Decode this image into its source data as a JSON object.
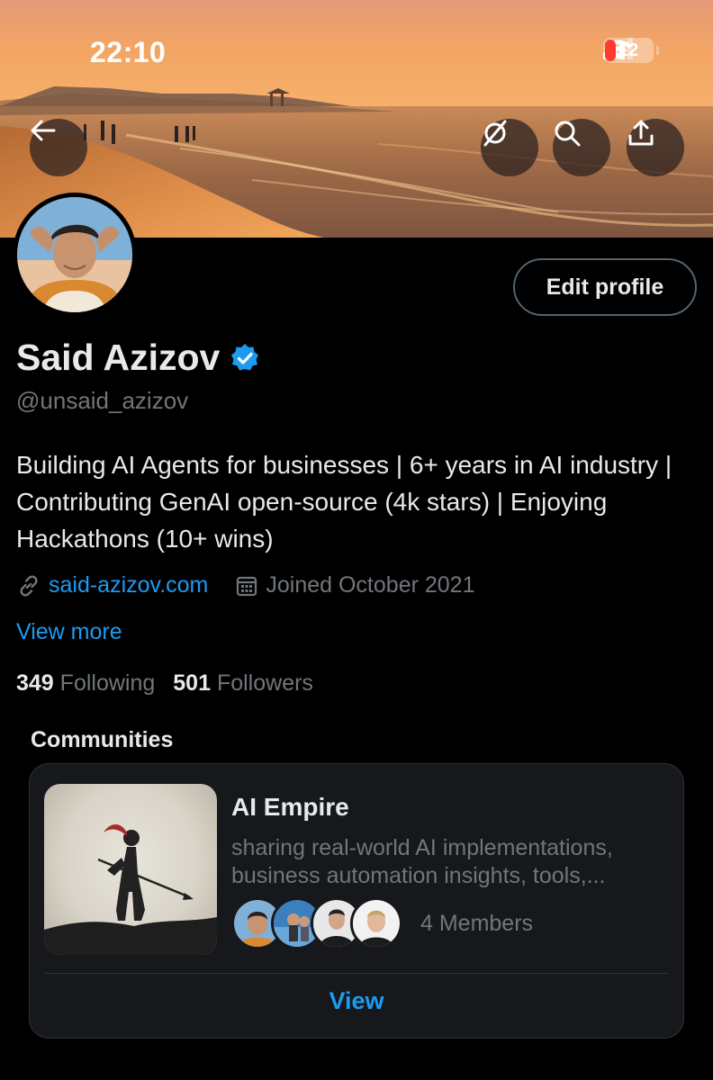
{
  "status_bar": {
    "time": "22:10",
    "battery_percent": "12",
    "icons": [
      "signal-icon",
      "wifi-icon",
      "battery-icon"
    ]
  },
  "header_actions": {
    "back_icon": "arrow-left-icon",
    "grok_icon": "grok-icon",
    "search_icon": "search-icon",
    "share_icon": "share-icon"
  },
  "profile": {
    "edit_label": "Edit profile",
    "display_name": "Said Azizov",
    "verified": true,
    "handle": "@unsaid_azizov",
    "bio": "Building AI Agents for businesses | 6+ years in AI industry | Contributing GenAI open-source (4k stars) | Enjoying Hackathons (10+ wins)",
    "website": "said-azizov.com",
    "joined": "Joined October 2021",
    "view_more": "View more",
    "following_count": "349",
    "following_label": "Following",
    "followers_count": "501",
    "followers_label": "Followers"
  },
  "communities": {
    "section_title": "Communities",
    "card": {
      "name": "AI Empire",
      "description": "sharing real-world AI implementations, business automation insights, tools,...",
      "members_label": "4 Members",
      "view_label": "View"
    }
  },
  "colors": {
    "accent": "#1d9bf0",
    "background": "#000000",
    "muted": "#71767b",
    "text": "#e7e9ea",
    "card": "#16181c"
  }
}
